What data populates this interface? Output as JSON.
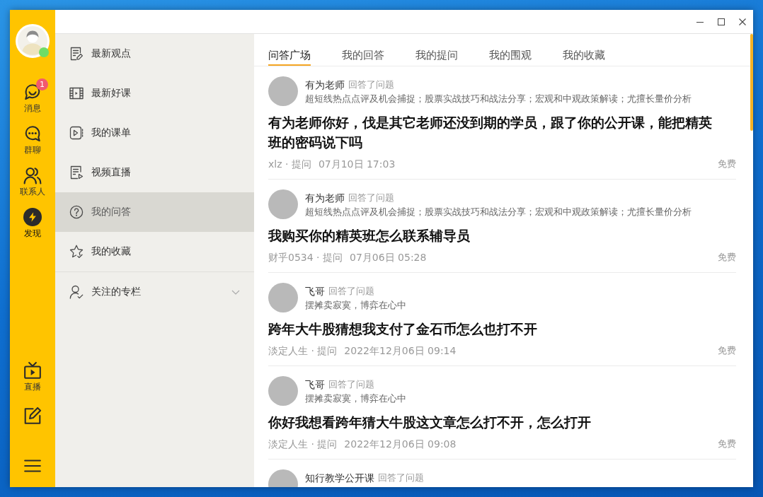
{
  "rail": {
    "user": {
      "online": true
    },
    "top_items": [
      {
        "kind": "chat-smile",
        "label": "消息",
        "badge": "1",
        "selected": false
      },
      {
        "kind": "chat-dots",
        "label": "群聊",
        "selected": false
      },
      {
        "kind": "contacts",
        "label": "联系人",
        "selected": false
      },
      {
        "kind": "lightning",
        "label": "发现",
        "selected": true
      }
    ],
    "bottom_items": [
      {
        "kind": "tv",
        "label": "直播",
        "selected": false
      },
      {
        "kind": "edit",
        "selected": false
      },
      {
        "kind": "menu",
        "selected": false
      }
    ]
  },
  "sidebar": {
    "items": [
      {
        "kind": "doc-edit",
        "label": "最新观点",
        "selected": false
      },
      {
        "kind": "film",
        "label": "最新好课",
        "selected": false
      },
      {
        "kind": "play-list",
        "label": "我的课单",
        "selected": false
      },
      {
        "kind": "doc-play",
        "label": "视频直播",
        "selected": false
      },
      {
        "kind": "question",
        "label": "我的问答",
        "selected": true
      },
      {
        "kind": "star-check",
        "label": "我的收藏",
        "selected": false
      }
    ],
    "followed": {
      "kind": "user-check",
      "label": "关注的专栏",
      "expanded": false
    }
  },
  "tabs": [
    {
      "label": "问答广场",
      "selected": true
    },
    {
      "label": "我的回答",
      "selected": false
    },
    {
      "label": "我的提问",
      "selected": false
    },
    {
      "label": "我的围观",
      "selected": false
    },
    {
      "label": "我的收藏",
      "selected": false
    }
  ],
  "feed": [
    {
      "author": "有为老师",
      "action": "回答了问题",
      "bio": "超短线热点点评及机会捕捉；股票实战技巧和战法分享；宏观和中观政策解读；尤擅长量价分析",
      "question": "有为老师你好，伐是其它老师还没到期的学员，跟了你的公开课，能把精英班的密码说下吗",
      "asker": "xlz · 提问",
      "time": "07月10日 17:03",
      "price": "免费"
    },
    {
      "author": "有为老师",
      "action": "回答了问题",
      "bio": "超短线热点点评及机会捕捉；股票实战技巧和战法分享；宏观和中观政策解读；尤擅长量价分析",
      "question": "我购买你的精英班怎么联系辅导员",
      "asker": "财乎0534 · 提问",
      "time": "07月06日 05:28",
      "price": "免费"
    },
    {
      "author": "飞哥",
      "action": "回答了问题",
      "bio": "摆摊卖寂寞，博弈在心中",
      "question": "跨年大牛股猜想我支付了金石币怎么也打不开",
      "asker": "淡定人生 · 提问",
      "time": "2022年12月06日 09:14",
      "price": "免费"
    },
    {
      "author": "飞哥",
      "action": "回答了问题",
      "bio": "摆摊卖寂寞，博弈在心中",
      "question": "你好我想看跨年猜大牛股这文章怎么打不开，怎么打开",
      "asker": "淡定人生 · 提问",
      "time": "2022年12月06日 09:08",
      "price": "免费"
    },
    {
      "author": "知行教学公开课",
      "action": "回答了问题"
    }
  ]
}
